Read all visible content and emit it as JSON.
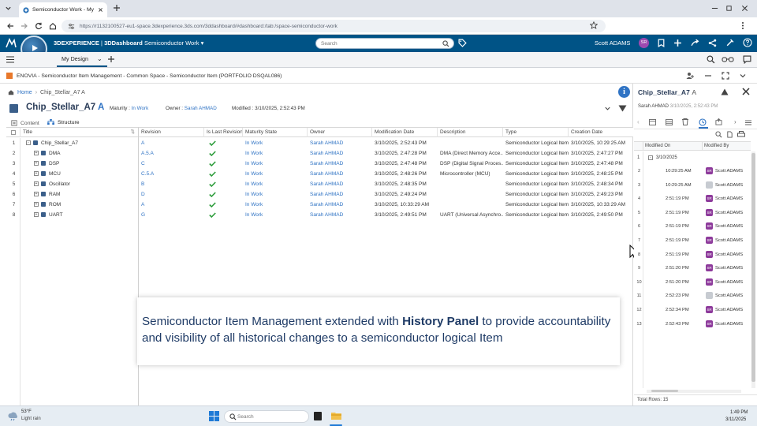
{
  "browser": {
    "tab_title": "Semiconductor Work - My Des",
    "url": "https://r1132100527-eu1-space.3dexperience.3ds.com/3ddashboard/#dashboard:/tab:/space-semiconductor-work"
  },
  "app": {
    "brand": "3DEXPERIENCE",
    "separator": " | ",
    "dashboard": "3DDashboard",
    "dashboard_name": "Semiconductor Work",
    "search_placeholder": "Search",
    "user_name": "Scott ADAMS",
    "user_initials": "SR",
    "compass_label": "V,R"
  },
  "subbar": {
    "tab_label": "My Design"
  },
  "widget": {
    "title": "ENOVIA - Semiconductor Item Management - Common Space - Semiconductor Item (PORTFOLIO DSQAL086)"
  },
  "breadcrumb": {
    "home": "Home",
    "current": "Chip_Stellar_A7 A"
  },
  "object": {
    "name": "Chip_Stellar_A7",
    "revision": "A",
    "maturity_label": "Maturity :",
    "maturity_value": "In Work",
    "owner_label": "Owner :",
    "owner_value": "Sarah AHMAD",
    "modified_label": "Modified :",
    "modified_value": "3/10/2025, 2:52:43 PM"
  },
  "tabs": [
    {
      "label": "Content"
    },
    {
      "label": "Structure"
    }
  ],
  "grid": {
    "columns": [
      "Title",
      "Revision",
      "Is Last Revision",
      "Maturity State",
      "Owner",
      "Modification Date",
      "Description",
      "Type",
      "Creation Date"
    ],
    "rows": [
      {
        "n": "1",
        "expand": "-",
        "title": "Chip_Stellar_A7",
        "revision": "A",
        "last": true,
        "state": "In Work",
        "owner": "Sarah AHMAD",
        "modified": "3/10/2025, 2:52:43 PM",
        "description": "",
        "type": "Semiconductor Logical Item",
        "created": "3/10/2025, 10:29:25 AM"
      },
      {
        "n": "2",
        "expand": "+",
        "title": "DMA",
        "revision": "A.5.A",
        "last": true,
        "state": "In Work",
        "owner": "Sarah AHMAD",
        "modified": "3/10/2025, 2:47:28 PM",
        "description": "DMA (Direct Memory Acce...",
        "type": "Semiconductor Logical Item",
        "created": "3/10/2025, 2:47:27 PM"
      },
      {
        "n": "3",
        "expand": "+",
        "title": "DSP",
        "revision": "C",
        "last": true,
        "state": "In Work",
        "owner": "Sarah AHMAD",
        "modified": "3/10/2025, 2:47:48 PM",
        "description": "DSP (Digital Signal Proces...",
        "type": "Semiconductor Logical Item",
        "created": "3/10/2025, 2:47:48 PM"
      },
      {
        "n": "4",
        "expand": "+",
        "title": "MCU",
        "revision": "C.5.A",
        "last": true,
        "state": "In Work",
        "owner": "Sarah AHMAD",
        "modified": "3/10/2025, 2:48:26 PM",
        "description": "Microcontroller (MCU)",
        "type": "Semiconductor Logical Item",
        "created": "3/10/2025, 2:48:25 PM"
      },
      {
        "n": "5",
        "expand": "+",
        "title": "Oscillator",
        "revision": "B",
        "last": true,
        "state": "In Work",
        "owner": "Sarah AHMAD",
        "modified": "3/10/2025, 2:48:35 PM",
        "description": "",
        "type": "Semiconductor Logical Item",
        "created": "3/10/2025, 2:48:34 PM"
      },
      {
        "n": "6",
        "expand": "+",
        "title": "RAM",
        "revision": "D",
        "last": true,
        "state": "In Work",
        "owner": "Sarah AHMAD",
        "modified": "3/10/2025, 2:49:24 PM",
        "description": "",
        "type": "Semiconductor Logical Item",
        "created": "3/10/2025, 2:49:23 PM"
      },
      {
        "n": "7",
        "expand": "+",
        "title": "ROM",
        "revision": "A",
        "last": true,
        "state": "In Work",
        "owner": "Sarah AHMAD",
        "modified": "3/10/2025, 10:33:29 AM",
        "description": "",
        "type": "Semiconductor Logical Item",
        "created": "3/10/2025, 10:33:29 AM"
      },
      {
        "n": "8",
        "expand": "+",
        "title": "UART",
        "revision": "G",
        "last": true,
        "state": "In Work",
        "owner": "Sarah AHMAD",
        "modified": "3/10/2025, 2:49:51 PM",
        "description": "UART (Universal Asynchro...",
        "type": "Semiconductor Logical Item",
        "created": "3/10/2025, 2:49:50 PM"
      }
    ]
  },
  "callout": {
    "text_before": "Semiconductor Item Management extended with ",
    "bold": "History Panel",
    "text_after": "  to  provide accountability and visibility of all historical changes to a semiconductor logical Item"
  },
  "panel": {
    "title": "Chip_Stellar_A7",
    "revision": "A",
    "owner": "Sarah AHMAD",
    "modified": "3/10/2025, 2:52:43 PM",
    "columns": [
      "Modified On",
      "Modified By"
    ],
    "group_label": "3/10/2025",
    "rows": [
      {
        "n": "2",
        "time": "10:29:25 AM",
        "by": "Scott ADAMS",
        "initials": "SR",
        "grey": false
      },
      {
        "n": "3",
        "time": "10:29:25 AM",
        "by": "Scott ADAMS",
        "initials": "",
        "grey": true
      },
      {
        "n": "4",
        "time": "2:51:19 PM",
        "by": "Scott ADAMS",
        "initials": "SR",
        "grey": false
      },
      {
        "n": "5",
        "time": "2:51:19 PM",
        "by": "Scott ADAMS",
        "initials": "SR",
        "grey": false
      },
      {
        "n": "6",
        "time": "2:51:19 PM",
        "by": "Scott ADAMS",
        "initials": "SR",
        "grey": false
      },
      {
        "n": "7",
        "time": "2:51:19 PM",
        "by": "Scott ADAMS",
        "initials": "SR",
        "grey": false
      },
      {
        "n": "8",
        "time": "2:51:19 PM",
        "by": "Scott ADAMS",
        "initials": "SR",
        "grey": false
      },
      {
        "n": "9",
        "time": "2:51:20 PM",
        "by": "Scott ADAMS",
        "initials": "SR",
        "grey": false
      },
      {
        "n": "10",
        "time": "2:51:20 PM",
        "by": "Scott ADAMS",
        "initials": "SR",
        "grey": false
      },
      {
        "n": "11",
        "time": "2:52:23 PM",
        "by": "Scott ADAMS",
        "initials": "",
        "grey": true
      },
      {
        "n": "12",
        "time": "2:52:34 PM",
        "by": "Scott ADAMS",
        "initials": "SR",
        "grey": false
      },
      {
        "n": "13",
        "time": "2:52:43 PM",
        "by": "Scott ADAMS",
        "initials": "SR",
        "grey": false
      }
    ],
    "total_rows": "Total Rows: 15"
  },
  "taskbar": {
    "temperature": "53°F",
    "weather": "Light rain",
    "search_placeholder": "Search",
    "time": "1:49 PM",
    "date": "3/11/2025"
  },
  "colors": {
    "brand_blue": "#005386",
    "link_blue": "#2f73c4",
    "check_green": "#2e9d3c",
    "avatar_purple": "#8d3a9b"
  }
}
